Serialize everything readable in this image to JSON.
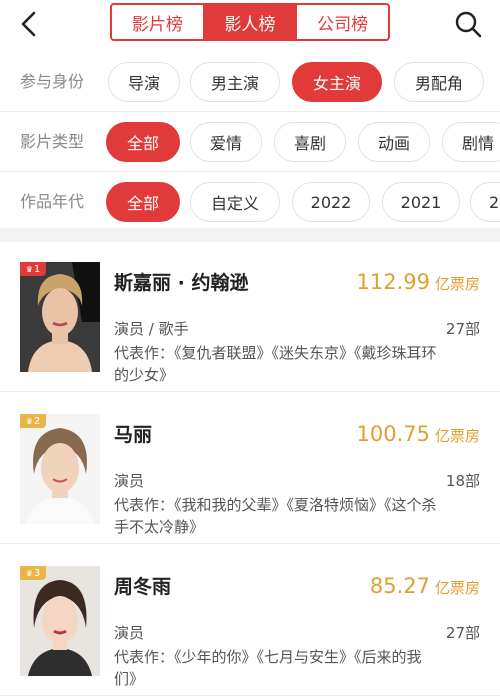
{
  "colors": {
    "accent": "#e03a3a",
    "boxoffice": "#e0a030",
    "rank1": "#e03a3a",
    "rank2": "#e8b547",
    "rank3": "#e8b547"
  },
  "header": {
    "back_icon": "chevron-left-icon",
    "search_icon": "search-icon",
    "tabs": [
      {
        "label": "影片榜",
        "active": false
      },
      {
        "label": "影人榜",
        "active": true
      },
      {
        "label": "公司榜",
        "active": false
      }
    ]
  },
  "filters": [
    {
      "label": "参与身份",
      "options": [
        "导演",
        "男主演",
        "女主演",
        "男配角"
      ],
      "selected": "女主演"
    },
    {
      "label": "影片类型",
      "options": [
        "全部",
        "爱情",
        "喜剧",
        "动画",
        "剧情"
      ],
      "selected": "全部"
    },
    {
      "label": "作品年代",
      "options": [
        "全部",
        "自定义",
        "2022",
        "2021",
        "2"
      ],
      "selected": "全部"
    }
  ],
  "list": [
    {
      "rank": "1",
      "name": "斯嘉丽 · 约翰逊",
      "boxoffice": "112.99",
      "unit": "亿票房",
      "role": "演员 / 歌手",
      "count": "27部",
      "works": "代表作：《复仇者联盟》《迷失东京》《戴珍珠耳环的少女》"
    },
    {
      "rank": "2",
      "name": "马丽",
      "boxoffice": "100.75",
      "unit": "亿票房",
      "role": "演员",
      "count": "18部",
      "works": "代表作：《我和我的父辈》《夏洛特烦恼》《这个杀手不太冷静》"
    },
    {
      "rank": "3",
      "name": "周冬雨",
      "boxoffice": "85.27",
      "unit": "亿票房",
      "role": "演员",
      "count": "27部",
      "works": "代表作：《少年的你》《七月与安生》《后来的我们》"
    }
  ]
}
